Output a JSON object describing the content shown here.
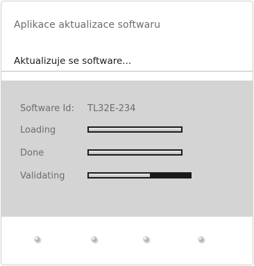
{
  "dialog": {
    "title": "Aplikace aktualizace softwaru",
    "status": "Aktualizuje se software..."
  },
  "details": {
    "software_id_label": "Software Id:",
    "software_id_value": "TL32E-234",
    "steps": [
      {
        "label": "Loading",
        "progress": 1.0
      },
      {
        "label": "Done",
        "progress": 1.0
      },
      {
        "label": "Validating",
        "progress": 0.6
      }
    ]
  },
  "footer": {
    "color_keys": [
      "red-key",
      "green-key",
      "yellow-key",
      "blue-key"
    ]
  }
}
